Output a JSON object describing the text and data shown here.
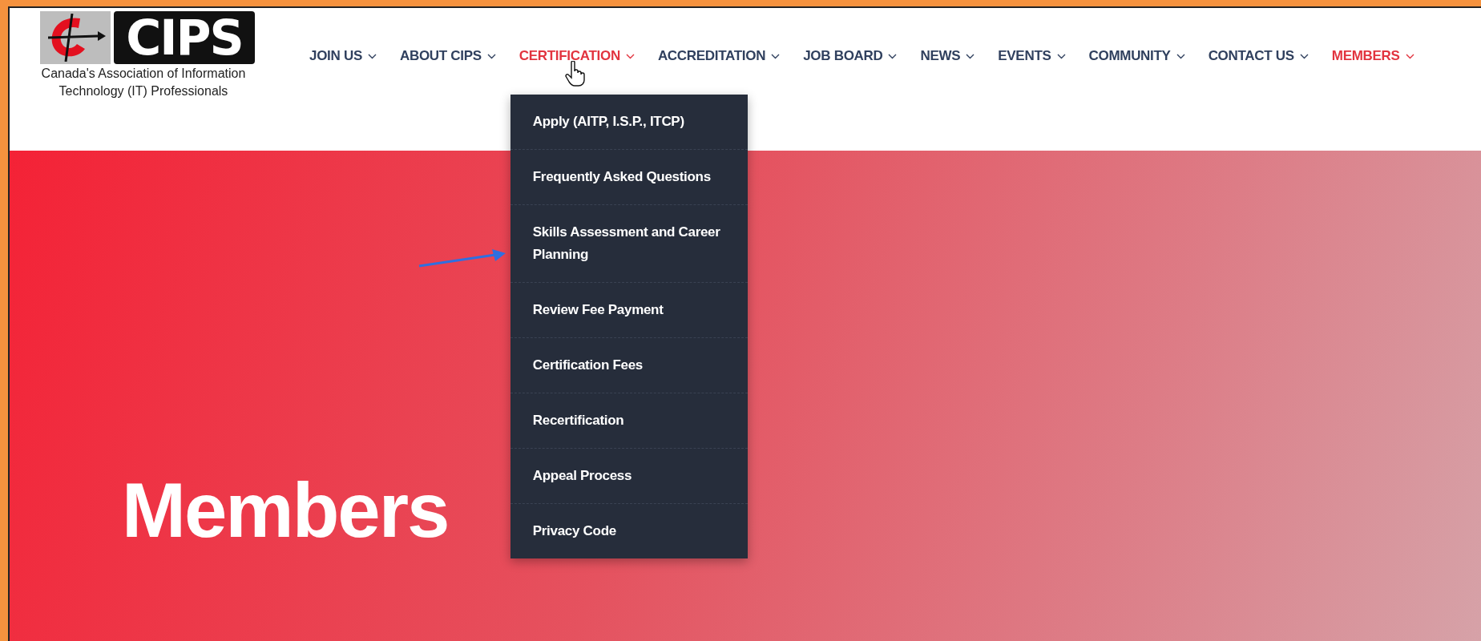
{
  "logo": {
    "wordmark": "CIPS",
    "tagline": [
      "Canada's Association of Information",
      "Technology (IT) Professionals"
    ]
  },
  "nav": [
    {
      "label": "JOIN US",
      "expanded": false,
      "current": false
    },
    {
      "label": "ABOUT CIPS",
      "expanded": false,
      "current": false
    },
    {
      "label": "CERTIFICATION",
      "expanded": true,
      "current": false,
      "menu": [
        "Apply (AITP, I.S.P., ITCP)",
        "Frequently Asked Questions",
        "Skills Assessment and Career Planning",
        "Review Fee Payment",
        "Certification Fees",
        "Recertification",
        "Appeal Process",
        "Privacy Code"
      ]
    },
    {
      "label": "ACCREDITATION",
      "expanded": false,
      "current": false
    },
    {
      "label": "JOB BOARD",
      "expanded": false,
      "current": false
    },
    {
      "label": "NEWS",
      "expanded": false,
      "current": false
    },
    {
      "label": "EVENTS",
      "expanded": false,
      "current": false
    },
    {
      "label": "COMMUNITY",
      "expanded": false,
      "current": false
    },
    {
      "label": "CONTACT US",
      "expanded": false,
      "current": false
    },
    {
      "label": "MEMBERS",
      "expanded": false,
      "current": true
    }
  ],
  "hero": {
    "title": "Members"
  }
}
